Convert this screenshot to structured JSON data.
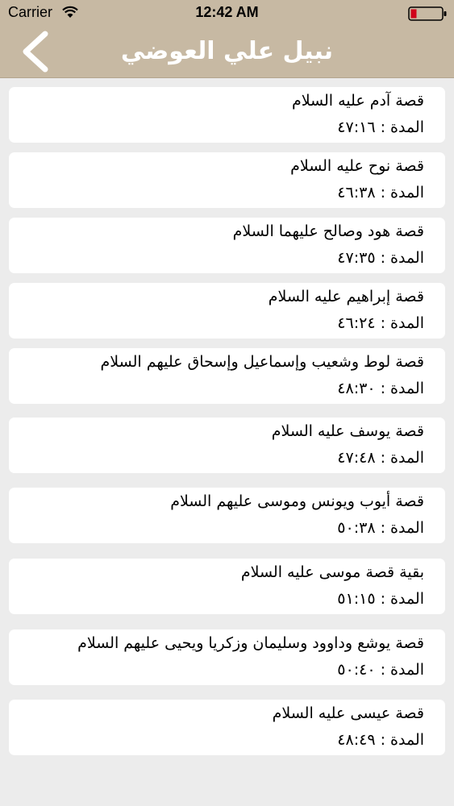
{
  "status_bar": {
    "carrier": "Carrier",
    "time": "12:42 AM"
  },
  "nav": {
    "title": "نبيل علي العوضي",
    "back_icon": "chevron-left-icon"
  },
  "duration_label": "المدة :",
  "items": [
    {
      "title": "قصة آدم عليه السلام",
      "duration": "٤٧:١٦"
    },
    {
      "title": "قصة نوح عليه السلام",
      "duration": "٤٦:٣٨"
    },
    {
      "title": "قصة هود وصالح عليهما السلام",
      "duration": "٤٧:٣٥"
    },
    {
      "title": "قصة إبراهيم عليه السلام",
      "duration": "٤٦:٢٤"
    },
    {
      "title": "قصة لوط وشعيب وإسماعيل وإسحاق عليهم السلام",
      "duration": "٤٨:٣٠"
    },
    {
      "title": "قصة يوسف عليه السلام",
      "duration": "٤٧:٤٨"
    },
    {
      "title": "قصة أيوب ويونس وموسى عليهم السلام",
      "duration": "٥٠:٣٨"
    },
    {
      "title": "بقية قصة موسى عليه السلام",
      "duration": "٥١:١٥"
    },
    {
      "title": "قصة يوشع وداوود وسليمان وزكريا ويحيى عليهم السلام",
      "duration": "٥٠:٤٠"
    },
    {
      "title": "قصة عيسى عليه السلام",
      "duration": "٤٨:٤٩"
    }
  ],
  "colors": {
    "nav_background": "#c7b9a3",
    "page_background": "#ececec",
    "card_background": "#ffffff"
  }
}
